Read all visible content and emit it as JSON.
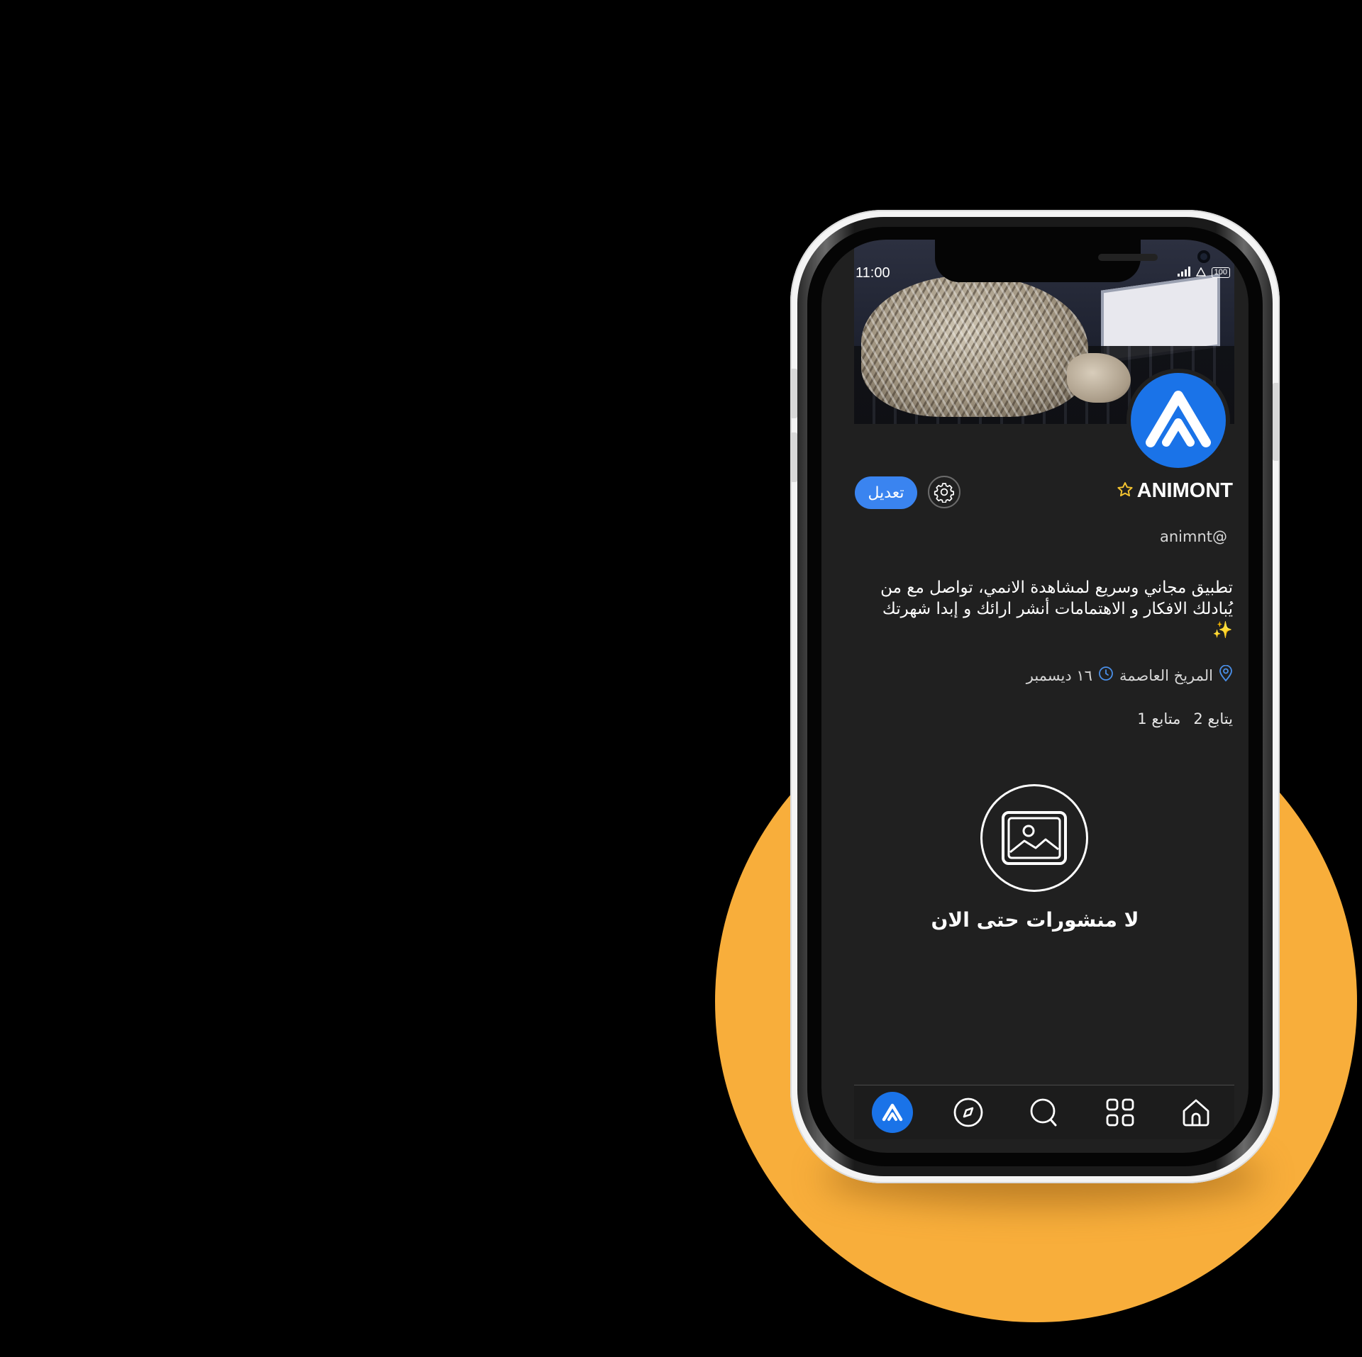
{
  "status_bar": {
    "time": "11:00",
    "battery": "100"
  },
  "profile": {
    "name": "ANIMONT",
    "handle": "animnt@",
    "edit_label": "تعديل",
    "bio": "تطبيق مجاني وسريع لمشاهدة الانمي، تواصل مع من يُبادلك الافكار و الاهتمامات أنشر ارائك و إبدا شهرتك ✨",
    "location": "المريخ العاصمة",
    "joined": "١٦ ديسمبر",
    "following_label": "يتابع",
    "following_count": "2",
    "followers_label": "متابع",
    "followers_count": "1"
  },
  "empty_state": {
    "message": "لا منشورات حتى الان"
  },
  "bottom_nav": [
    "profile",
    "explore",
    "search",
    "apps",
    "home"
  ],
  "colors": {
    "accent": "#1a73e8",
    "background": "#202020",
    "backdrop_circle": "#f8ae3b",
    "star": "#f4c430"
  }
}
